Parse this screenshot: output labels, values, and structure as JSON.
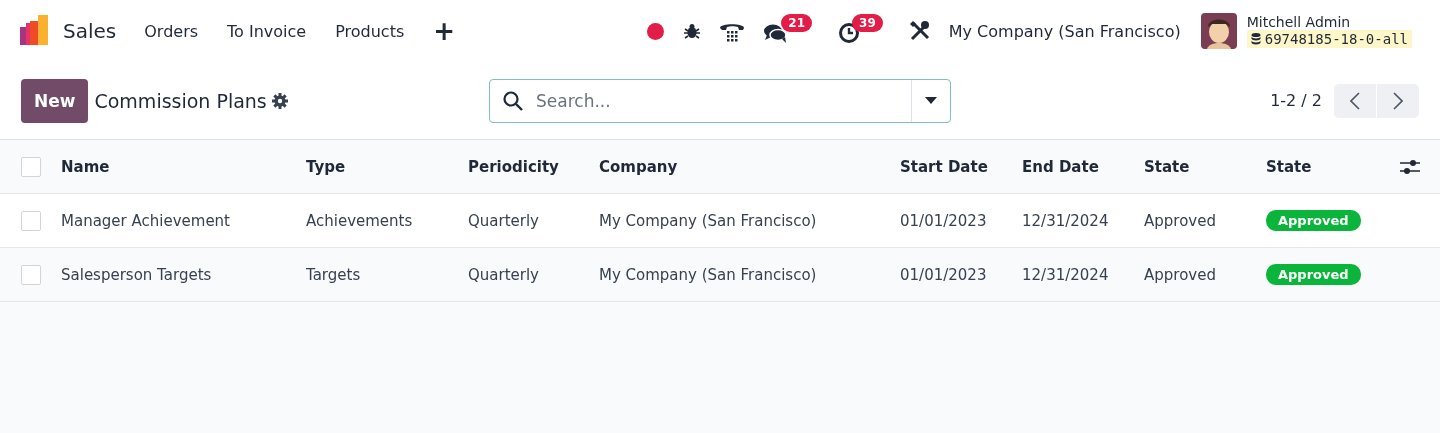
{
  "navbar": {
    "app_name": "Sales",
    "menu": [
      "Orders",
      "To Invoice",
      "Products"
    ],
    "add_label": "+",
    "messages_count": "21",
    "activities_count": "39",
    "company": "My Company (San Francisco)",
    "user": {
      "name": "Mitchell Admin",
      "database": "69748185-18-0-all"
    }
  },
  "control_panel": {
    "new_button": "New",
    "title": "Commission Plans",
    "search": {
      "placeholder": "Search..."
    },
    "pager": "1-2 / 2"
  },
  "table": {
    "all_selected": false,
    "columns": [
      "Name",
      "Type",
      "Periodicity",
      "Company",
      "Start Date",
      "End Date",
      "State",
      "State"
    ],
    "rows": [
      {
        "selected": false,
        "cells": [
          "Manager Achievement",
          "Achievements",
          "Quarterly",
          "My Company (San Francisco)",
          "01/01/2023",
          "12/31/2024",
          "Approved"
        ],
        "badge": {
          "label": "Approved",
          "color": "#0bb53b"
        }
      },
      {
        "selected": false,
        "cells": [
          "Salesperson Targets",
          "Targets",
          "Quarterly",
          "My Company (San Francisco)",
          "01/01/2023",
          "12/31/2024",
          "Approved"
        ],
        "badge": {
          "label": "Approved",
          "color": "#0bb53b"
        }
      }
    ]
  }
}
